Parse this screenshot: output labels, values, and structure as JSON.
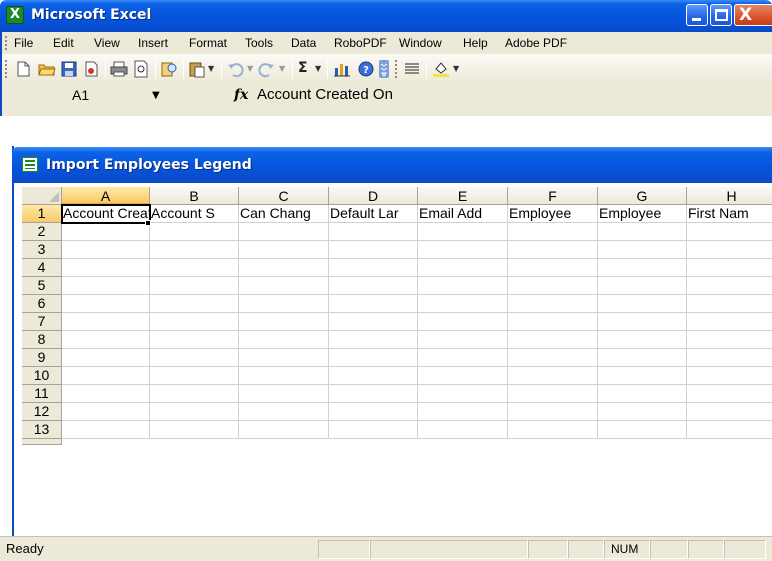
{
  "window": {
    "title": "Microsoft Excel",
    "icon_name": "excel-icon",
    "close_glyph": "X"
  },
  "menu": {
    "items": [
      "File",
      "Edit",
      "View",
      "Insert",
      "Format",
      "Tools",
      "Data",
      "RoboPDF",
      "Window",
      "Help",
      "Adobe PDF"
    ]
  },
  "toolbar": {
    "icons": [
      "new-icon",
      "open-icon",
      "save-icon",
      "permission-icon",
      "print-icon",
      "print-preview-icon",
      "research-icon",
      "paste-icon",
      "undo-icon",
      "redo-icon",
      "autosum-icon",
      "chart-wizard-icon",
      "help-icon",
      "toolbar-options-icon",
      "align-icon",
      "fill-color-icon"
    ],
    "autosum_glyph": "Σ"
  },
  "formula_bar": {
    "name_box": "A1",
    "fx": "fx",
    "content": "Account Created On"
  },
  "workbook": {
    "title": "Import Employees Legend"
  },
  "grid": {
    "columns": [
      "A",
      "B",
      "C",
      "D",
      "E",
      "F",
      "G",
      "H"
    ],
    "rows": [
      "1",
      "2",
      "3",
      "4",
      "5",
      "6",
      "7",
      "8",
      "9",
      "10",
      "11",
      "12",
      "13"
    ],
    "row1": [
      "Account Created On",
      "Account S",
      "Can Chang",
      "Default Lar",
      "Email Add",
      "Employee",
      "Employee",
      "First Nam"
    ],
    "selected_cell": "A1"
  },
  "status": {
    "text": "Ready",
    "num": "NUM"
  },
  "colors": {
    "title_blue": "#0654dd",
    "face": "#ece9d8",
    "active_header": "#f9c96a",
    "excel_green": "#1c8a2c"
  }
}
